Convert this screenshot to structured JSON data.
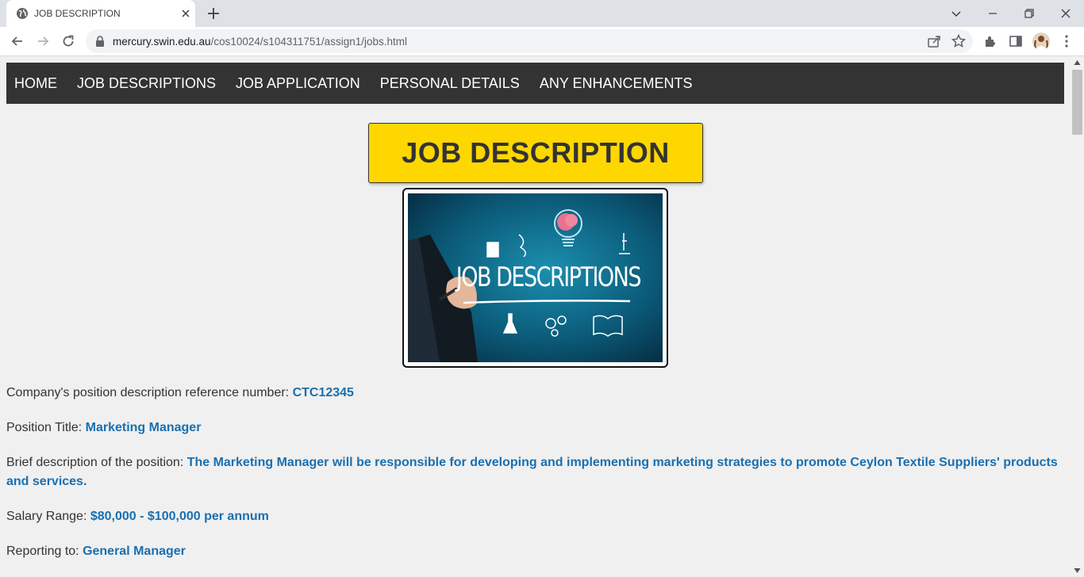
{
  "browser": {
    "tab_title": "JOB DESCRIPTION",
    "url_host": "mercury.swin.edu.au",
    "url_path": "/cos10024/s104311751/assign1/jobs.html"
  },
  "nav": {
    "items": [
      "HOME",
      "JOB DESCRIPTIONS",
      "JOB APPLICATION",
      "PERSONAL DETAILS",
      "ANY ENHANCEMENTS"
    ]
  },
  "heading": "JOB DESCRIPTION",
  "hero_image": {
    "text": "JOB DESCRIPTIONS"
  },
  "details": {
    "reference": {
      "label": "Company's position description reference number: ",
      "value": "CTC12345"
    },
    "title": {
      "label": "Position Title: ",
      "value": "Marketing Manager"
    },
    "description": {
      "label": "Brief description of the position: ",
      "value": "The Marketing Manager will be responsible for developing and implementing marketing strategies to promote Ceylon Textile Suppliers' products and services."
    },
    "salary": {
      "label": "Salary Range: ",
      "value": "$80,000 - $100,000 per annum"
    },
    "reporting": {
      "label": "Reporting to: ",
      "value": "General Manager"
    }
  },
  "colors": {
    "nav_bg": "#333333",
    "heading_bg": "#ffd700",
    "value_text": "#1a6fb0",
    "page_bg": "#f0f0f0"
  }
}
